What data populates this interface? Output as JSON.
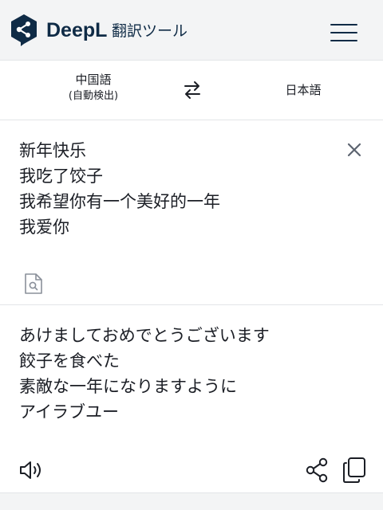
{
  "header": {
    "brand": "DeepL",
    "subtitle": "翻訳ツール",
    "logo_icon": "deepl-logo-icon",
    "menu_icon": "hamburger-menu-icon",
    "brand_color": "#0f2b46"
  },
  "languages": {
    "source": "中国語",
    "source_detect": "(自動検出)",
    "swap_icon": "swap-arrows-icon",
    "target": "日本語"
  },
  "source": {
    "lines": [
      "新年快乐",
      "我吃了饺子",
      "我希望你有一个美好的一年",
      "我爱你"
    ],
    "clear_icon": "close-icon",
    "dictionary_icon": "dictionary-search-icon"
  },
  "target": {
    "lines": [
      "あけましておめでとうございます",
      "餃子を食べた",
      "素敵な一年になりますように",
      "アイラブユー"
    ],
    "speaker_icon": "speaker-icon",
    "share_icon": "share-icon",
    "copy_icon": "copy-icon"
  }
}
